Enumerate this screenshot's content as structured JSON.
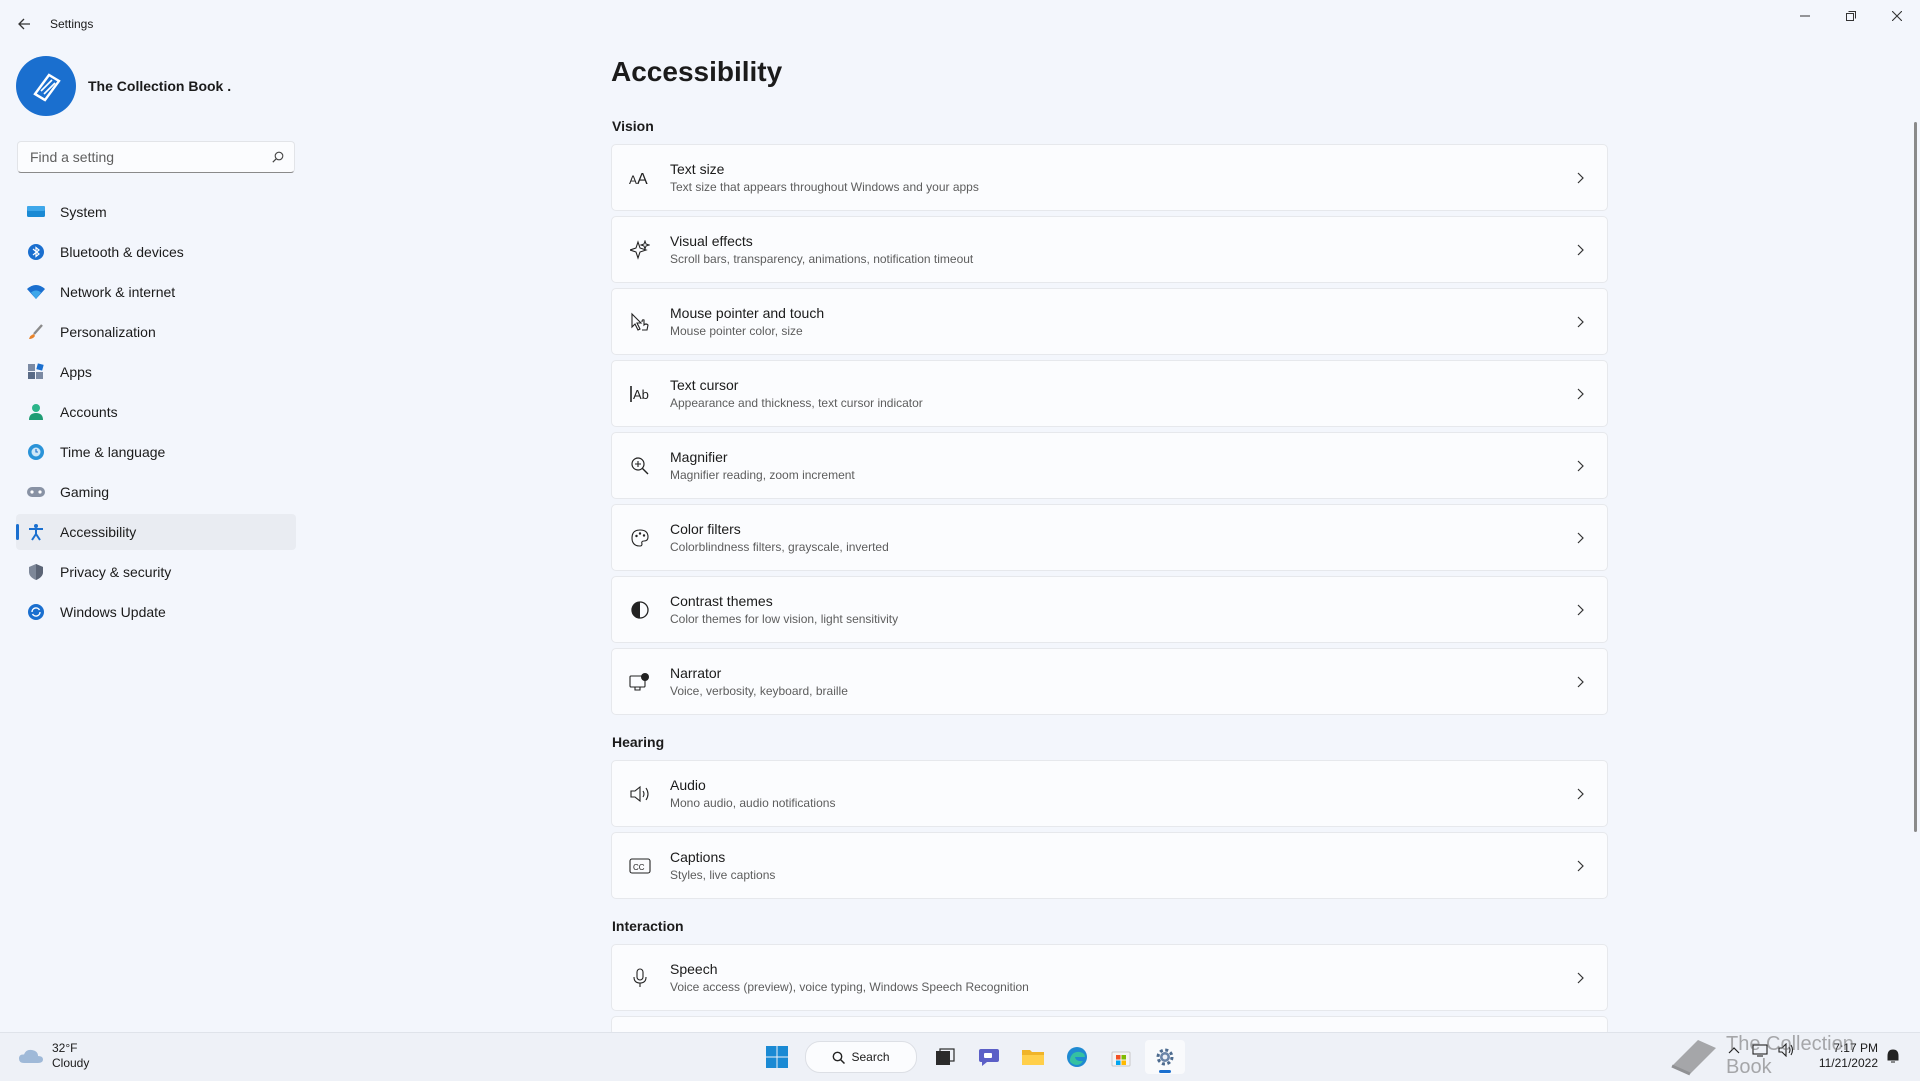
{
  "window": {
    "title": "Settings"
  },
  "profile": {
    "name": "The Collection Book ."
  },
  "search": {
    "placeholder": "Find a setting"
  },
  "nav": [
    {
      "label": "System",
      "icon": "system-icon"
    },
    {
      "label": "Bluetooth & devices",
      "icon": "bluetooth-icon"
    },
    {
      "label": "Network & internet",
      "icon": "wifi-icon"
    },
    {
      "label": "Personalization",
      "icon": "brush-icon"
    },
    {
      "label": "Apps",
      "icon": "apps-icon"
    },
    {
      "label": "Accounts",
      "icon": "accounts-icon"
    },
    {
      "label": "Time & language",
      "icon": "globe-clock-icon"
    },
    {
      "label": "Gaming",
      "icon": "gamepad-icon"
    },
    {
      "label": "Accessibility",
      "icon": "accessibility-icon",
      "selected": true
    },
    {
      "label": "Privacy & security",
      "icon": "shield-icon"
    },
    {
      "label": "Windows Update",
      "icon": "update-icon"
    }
  ],
  "page": {
    "title": "Accessibility",
    "sections": {
      "vision": "Vision",
      "hearing": "Hearing",
      "interaction": "Interaction"
    },
    "items": [
      {
        "title": "Text size",
        "subtitle": "Text size that appears throughout Windows and your apps",
        "icon": "text-size-icon"
      },
      {
        "title": "Visual effects",
        "subtitle": "Scroll bars, transparency, animations, notification timeout",
        "icon": "sparkle-icon"
      },
      {
        "title": "Mouse pointer and touch",
        "subtitle": "Mouse pointer color, size",
        "icon": "pointer-touch-icon"
      },
      {
        "title": "Text cursor",
        "subtitle": "Appearance and thickness, text cursor indicator",
        "icon": "text-cursor-icon"
      },
      {
        "title": "Magnifier",
        "subtitle": "Magnifier reading, zoom increment",
        "icon": "magnifier-icon"
      },
      {
        "title": "Color filters",
        "subtitle": "Colorblindness filters, grayscale, inverted",
        "icon": "palette-icon"
      },
      {
        "title": "Contrast themes",
        "subtitle": "Color themes for low vision, light sensitivity",
        "icon": "contrast-icon"
      },
      {
        "title": "Narrator",
        "subtitle": "Voice, verbosity, keyboard, braille",
        "icon": "narrator-icon"
      },
      {
        "title": "Audio",
        "subtitle": "Mono audio, audio notifications",
        "icon": "speaker-icon"
      },
      {
        "title": "Captions",
        "subtitle": "Styles, live captions",
        "icon": "captions-icon"
      },
      {
        "title": "Speech",
        "subtitle": "Voice access (preview), voice typing, Windows Speech Recognition",
        "icon": "microphone-icon"
      }
    ]
  },
  "taskbar": {
    "weather_temp": "32°F",
    "weather_desc": "Cloudy",
    "search_label": "Search",
    "time": "7:17 PM",
    "date": "11/21/2022",
    "watermark": "The Collection Book"
  },
  "colors": {
    "accent": "#1a6fcf",
    "background": "#f3f6fc",
    "card": "#fbfcfe"
  }
}
